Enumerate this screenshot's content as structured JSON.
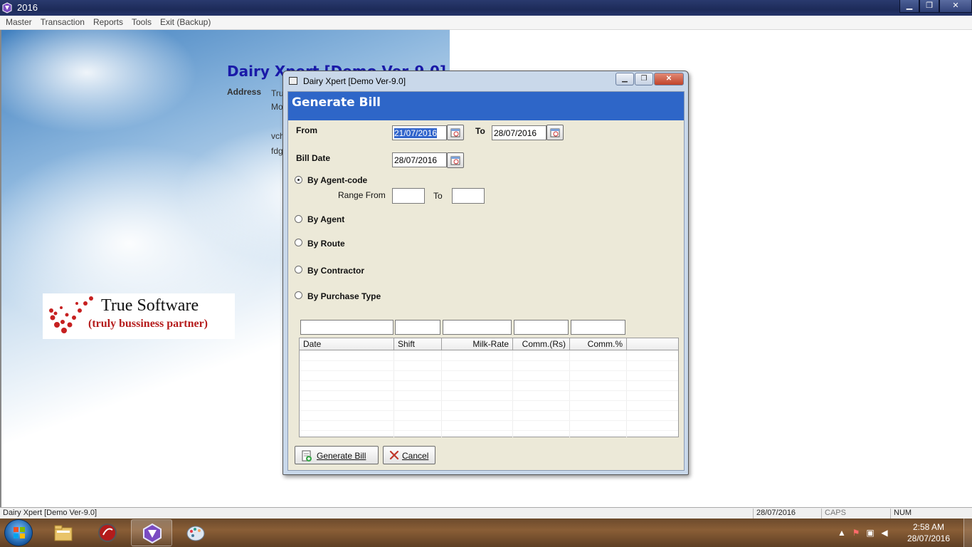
{
  "window": {
    "title": "2016",
    "minimize_glyph": "▁",
    "restore_glyph": "❐",
    "close_glyph": "✕"
  },
  "menu": [
    "Master",
    "Transaction",
    "Reports",
    "Tools",
    "Exit (Backup)"
  ],
  "background": {
    "company_name": "Dairy Xpert [Demo Ver-9.0]",
    "address_label": "Address",
    "address_lines": [
      "Tru",
      "Mo",
      "vch",
      "fdg"
    ],
    "logo_title": "True Software",
    "logo_subtitle": "(truly bussiness partner)"
  },
  "dialog": {
    "title": "Dairy Xpert [Demo Ver-9.0]",
    "header": "Generate Bill",
    "from_label": "From",
    "from_value": "21/07/2016",
    "to_label": "To",
    "to_value": "28/07/2016",
    "bill_date_label": "Bill Date",
    "bill_date_value": "28/07/2016",
    "options": [
      {
        "label": "By Agent-code",
        "checked": true
      },
      {
        "label": "By Agent",
        "checked": false
      },
      {
        "label": "By Route",
        "checked": false
      },
      {
        "label": "By Contractor",
        "checked": false
      },
      {
        "label": "By Purchase Type",
        "checked": false
      }
    ],
    "range_from_label": "Range From",
    "range_to_label": "To",
    "range_from_value": "",
    "range_to_value": "",
    "grid_columns": [
      "Date",
      "Shift",
      "Milk-Rate",
      "Comm.(Rs)",
      "Comm.%"
    ],
    "grid_rows": [],
    "generate_button": "Generate Bill",
    "cancel_button": "Cancel"
  },
  "statusbar": {
    "app": "Dairy Xpert [Demo Ver-9.0]",
    "date": "28/07/2016",
    "caps": "CAPS",
    "num": "NUM"
  },
  "taskbar": {
    "time": "2:58 AM",
    "date": "28/07/2016"
  },
  "colors": {
    "header_band": "#2e66c8",
    "company_name": "#1a1aa8",
    "logo_subtitle": "#b51c1c"
  }
}
